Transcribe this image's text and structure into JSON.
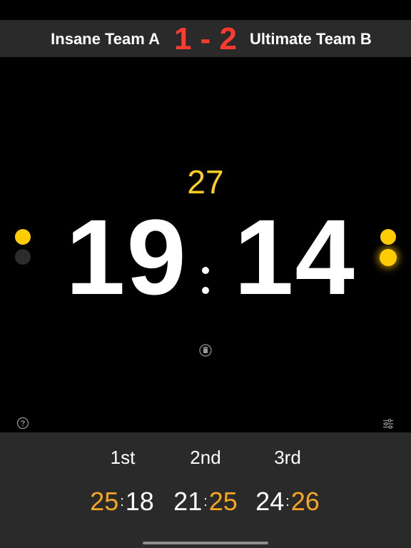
{
  "header": {
    "team_a": "Insane Team A",
    "team_b": "Ultimate Team B",
    "match_score": "1 - 2"
  },
  "game": {
    "top_number": "27",
    "score_a": "19",
    "score_b": "14"
  },
  "sets": [
    {
      "label": "1st",
      "score_a": "25",
      "score_b": "18",
      "winner": "a"
    },
    {
      "label": "2nd",
      "score_a": "21",
      "score_b": "25",
      "winner": "b"
    },
    {
      "label": "3rd",
      "score_a": "24",
      "score_b": "26",
      "winner": "b"
    }
  ],
  "icons": {
    "help": "question-circle-icon",
    "delete": "trash-icon",
    "settings": "sliders-icon"
  },
  "colors": {
    "accent_yellow": "#ffcc00",
    "match_score_red": "#ff3b30",
    "set_winner_orange": "#f5a623",
    "panel_gray": "#2a2a2a"
  }
}
